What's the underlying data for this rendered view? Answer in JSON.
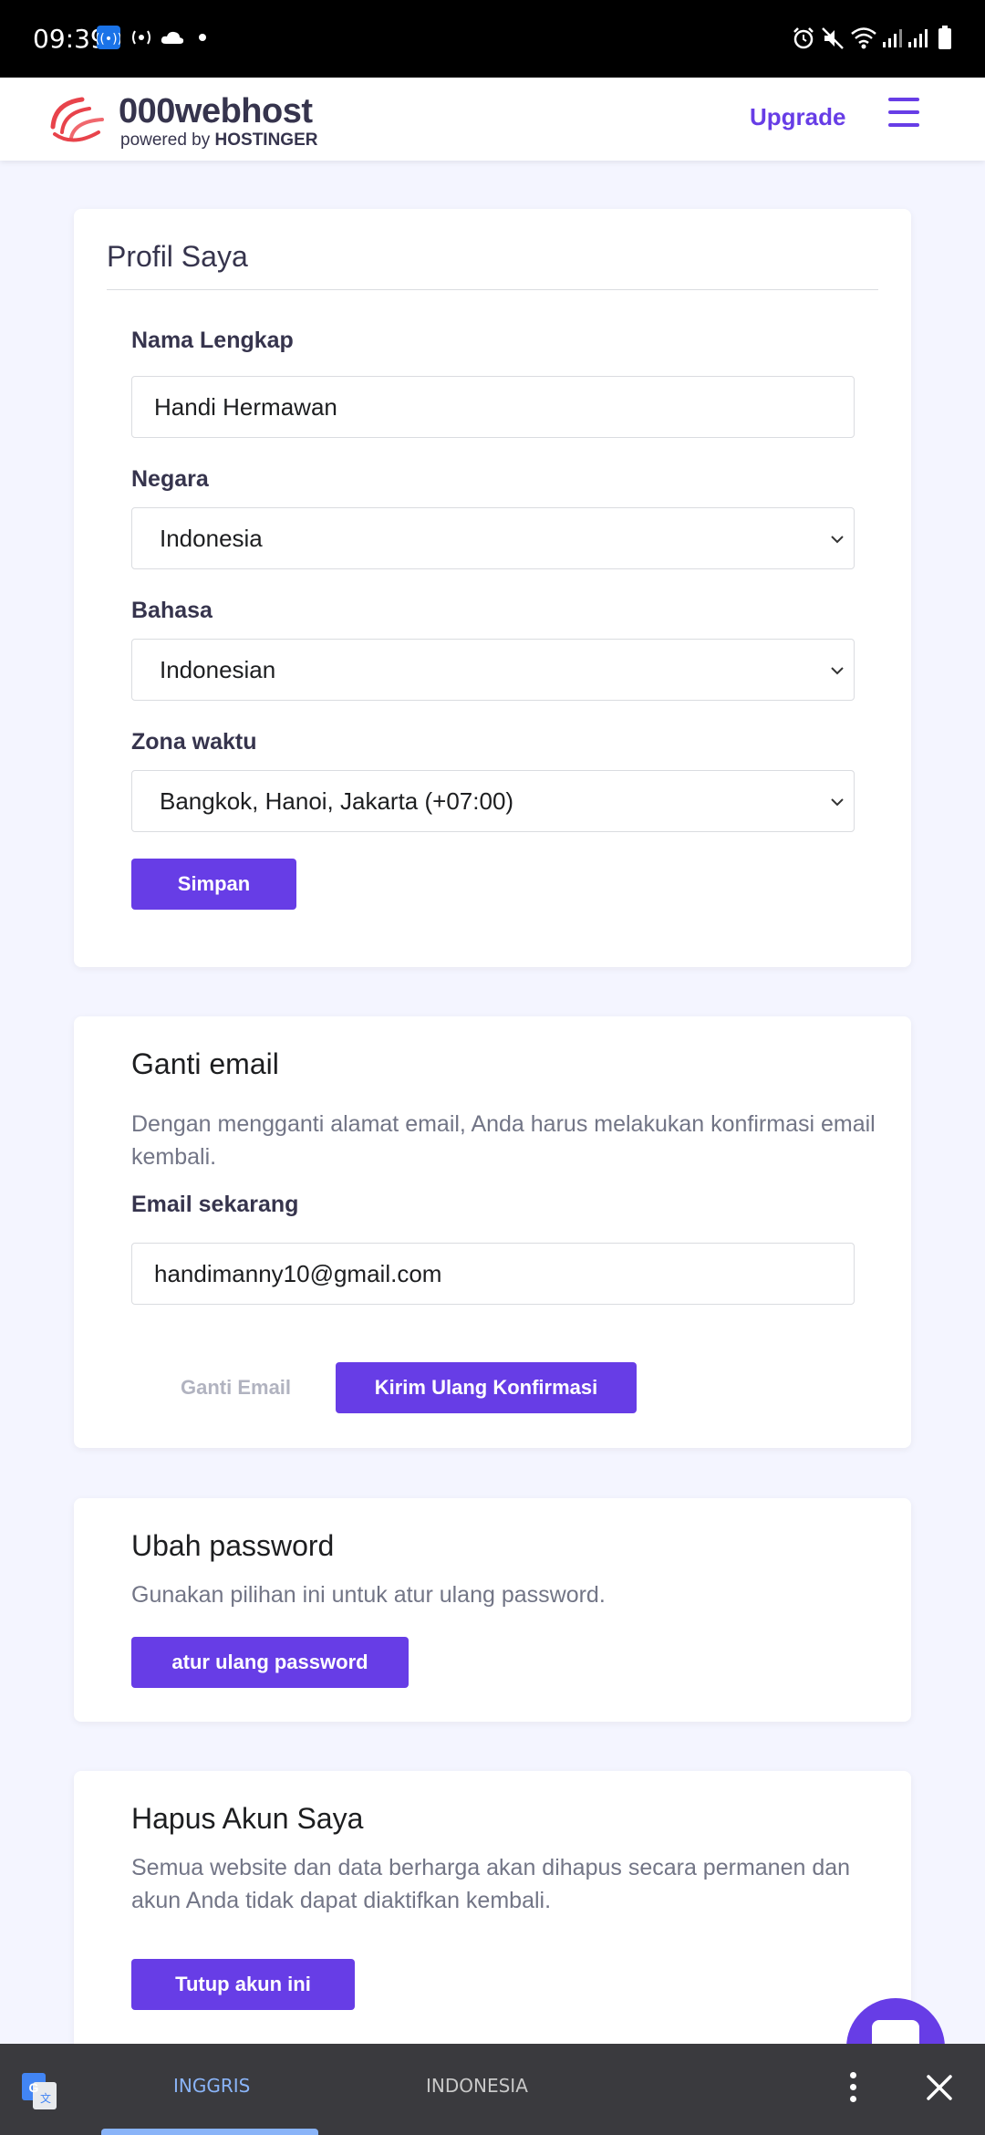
{
  "status_bar": {
    "time": "09:39"
  },
  "header": {
    "brand": "000webhost",
    "powered_by": "powered by",
    "powered_by_brand": "HOSTINGER",
    "upgrade_label": "Upgrade"
  },
  "profile": {
    "title": "Profil Saya",
    "full_name_label": "Nama Lengkap",
    "full_name_value": "Handi Hermawan",
    "country_label": "Negara",
    "country_value": "Indonesia",
    "language_label": "Bahasa",
    "language_value": "Indonesian",
    "timezone_label": "Zona waktu",
    "timezone_value": "Bangkok, Hanoi, Jakarta (+07:00)",
    "save_label": "Simpan"
  },
  "change_email": {
    "title": "Ganti email",
    "description": "Dengan mengganti alamat email, Anda harus melakukan konfirmasi email kembali.",
    "current_label": "Email sekarang",
    "current_value": "handimanny10@gmail.com",
    "change_label": "Ganti Email",
    "resend_label": "Kirim Ulang Konfirmasi"
  },
  "change_password": {
    "title": "Ubah password",
    "description": "Gunakan pilihan ini untuk atur ulang password.",
    "reset_label": "atur ulang password"
  },
  "delete_account": {
    "title": "Hapus Akun Saya",
    "description": "Semua website dan data berharga akan dihapus secara permanen dan akun Anda tidak dapat diaktifkan kembali.",
    "close_label": "Tutup akun ini"
  },
  "translate_bar": {
    "source_lang": "INGGRIS",
    "target_lang": "INDONESIA"
  },
  "colors": {
    "accent": "#673de6",
    "background": "#f4f5ff",
    "translate_bar": "#3a3a3e"
  }
}
